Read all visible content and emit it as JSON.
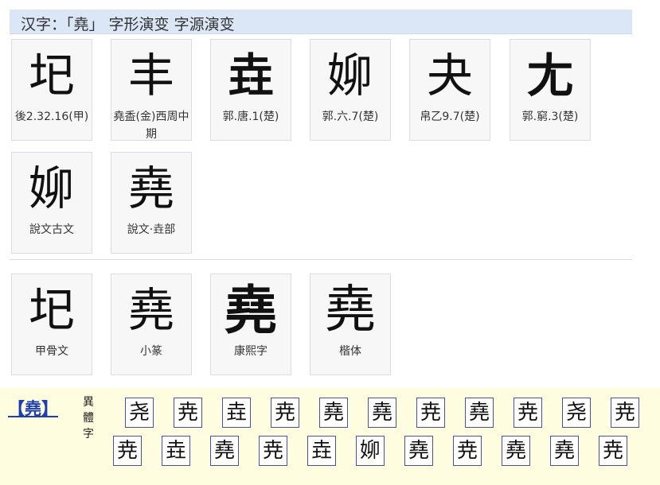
{
  "header": {
    "title": "汉字：「堯」 字形演变 字源演变"
  },
  "evolution_cards": [
    {
      "glyph": "𡉏",
      "caption": "後2.32.16(甲)"
    },
    {
      "glyph": "丰",
      "caption": "堯盉(金)西周中期"
    },
    {
      "glyph": "垚",
      "caption": "郭.唐.1(楚)"
    },
    {
      "glyph": "㚹",
      "caption": "郭.六.7(楚)"
    },
    {
      "glyph": "夬",
      "caption": "帛乙9.7(楚)"
    },
    {
      "glyph": "尢",
      "caption": "郭.窮.3(楚)"
    },
    {
      "glyph": "㚹",
      "caption": "說文古文"
    },
    {
      "glyph": "堯",
      "caption": "說文·垚部"
    }
  ],
  "script_cards": [
    {
      "glyph": "𡉏",
      "caption": "甲骨文"
    },
    {
      "glyph": "堯",
      "caption": "小篆"
    },
    {
      "glyph": "堯",
      "caption": "康熙字"
    },
    {
      "glyph": "堯",
      "caption": "楷体"
    }
  ],
  "variants": {
    "main": "【堯】",
    "label": "異體字",
    "row1": [
      "尧",
      "尭",
      "垚",
      "尭",
      "堯",
      "堯",
      "尭",
      "堯",
      "尭",
      "尧",
      "尭"
    ],
    "row2": [
      "尭",
      "垚",
      "堯",
      "尭",
      "垚",
      "㚹",
      "堯",
      "尭",
      "堯",
      "堯",
      "尭"
    ]
  }
}
